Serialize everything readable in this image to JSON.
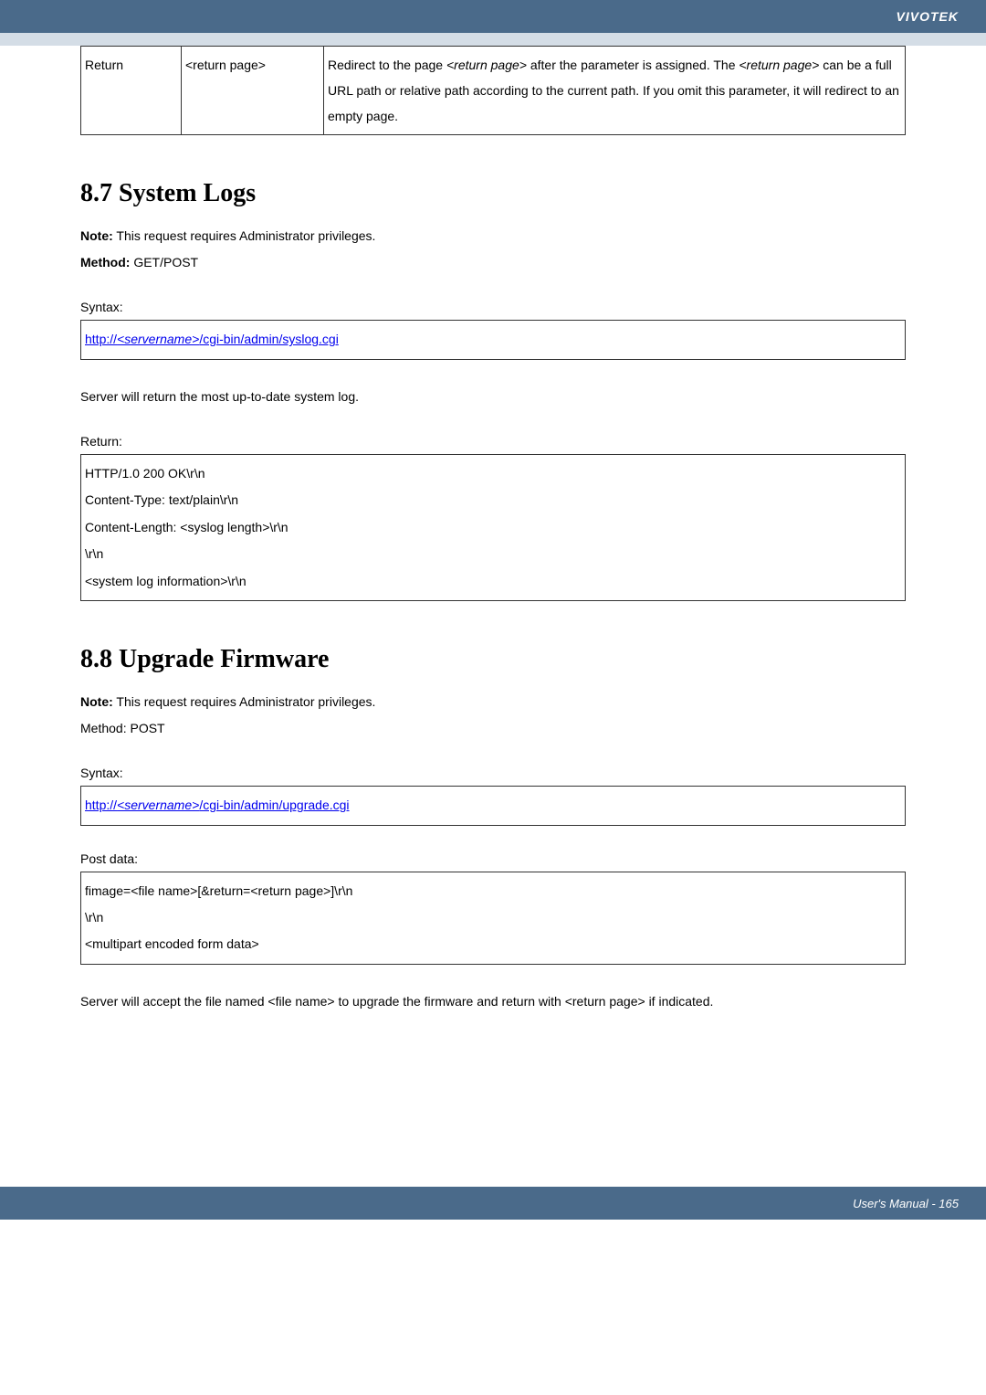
{
  "brand": "VIVOTEK",
  "table": {
    "c1": "Return",
    "c2": "<return page>",
    "c3p1": "Redirect to the page ",
    "c3i1": "<return page>",
    "c3p2": " after the parameter is assigned. The ",
    "c3i2": "<return page>",
    "c3p3": " can be a full URL path or relative path according to the current path. If you omit this parameter, it will redirect to an empty page."
  },
  "s1": {
    "heading": "8.7 System Logs",
    "noteLabel": "Note:",
    "note": " This request requires Administrator privileges.",
    "methodLabel": "Method:",
    "method": " GET/POST",
    "syntaxLabel": "Syntax:",
    "url_pre": "http://",
    "url_mid": "<servername>",
    "url_post": "/cgi-bin/admin/syslog.cgi",
    "desc": "Server will return the most up-to-date system log.",
    "returnLabel": "Return:",
    "ret1": "HTTP/1.0 200 OK\\r\\n",
    "ret2": "Content-Type: text/plain\\r\\n",
    "ret3": "Content-Length: <syslog length>\\r\\n",
    "ret4": "\\r\\n",
    "ret5": "<system log information>\\r\\n"
  },
  "s2": {
    "heading": "8.8 Upgrade Firmware",
    "noteLabel": "Note:",
    "note": " This request requires Administrator privileges.",
    "method": "Method: POST",
    "syntaxLabel": "Syntax:",
    "url_pre": "http://",
    "url_mid": "<servername>",
    "url_post": "/cgi-bin/admin/upgrade.cgi",
    "postLabel": "Post data:",
    "pd1": "fimage=<file name>[&return=<return page>]\\r\\n",
    "pd2": "\\r\\n",
    "pd3": "<multipart encoded form data>",
    "desc": "Server will accept the file named <file name> to upgrade the firmware and return with <return page> if indicated."
  },
  "footer": "User's Manual - 165"
}
